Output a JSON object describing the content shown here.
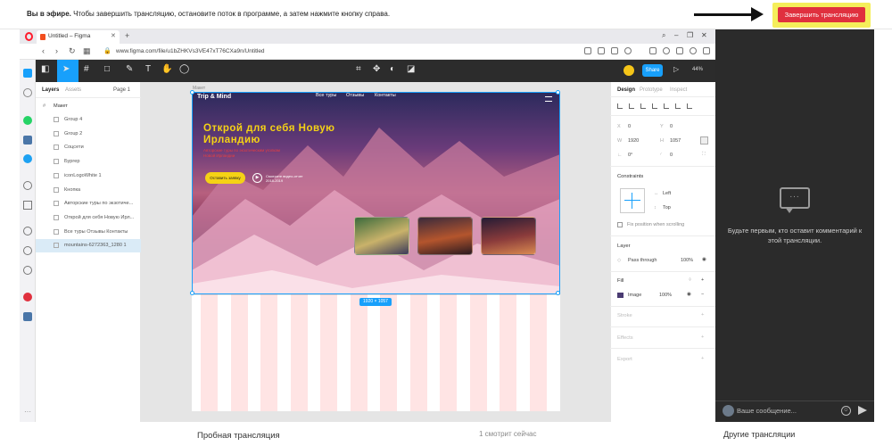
{
  "live_bar": {
    "bold": "Вы в эфире.",
    "text": " Чтобы завершить трансляцию, остановите поток в программе, а затем нажмите кнопку справа.",
    "end_button": "Завершить трансляцию",
    "accent": "#e0303e",
    "highlight": "#f5ee5a"
  },
  "browser": {
    "tab_title": "Untitled – Figma",
    "url": "www.figma.com/file/u1bZHKVs3VE47xT76CXa9n/Untitled"
  },
  "figma": {
    "share_label": "Share",
    "zoom": "44%",
    "accent": "#18a0fb",
    "layers": {
      "tab_layers": "Layers",
      "tab_assets": "Assets",
      "page": "Page 1",
      "frame": "Макет",
      "items": [
        {
          "label": "Group 4"
        },
        {
          "label": "Group 2"
        },
        {
          "label": "Соцсети"
        },
        {
          "label": "Бургер"
        },
        {
          "label": "iconLogoWhite 1"
        },
        {
          "label": "Кнопка"
        },
        {
          "label": "Авторские туры по экзотиче..."
        },
        {
          "label": "Открой для себя Новую Ирл..."
        },
        {
          "label": "Все туры Отзывы Контакты"
        },
        {
          "label": "mountains-6272363_1280 1"
        }
      ]
    },
    "canvas": {
      "frame_label": "Макет",
      "size_badge": "1920 × 1057",
      "hero": {
        "logo": "Trip & Mind",
        "nav": [
          "Все туры",
          "Отзывы",
          "Контакты"
        ],
        "title": "Открой для себя Новую Ирландию",
        "subtitle": "Авторские туры по экзотическим уголкам Новой Ирландии",
        "button": "Оставить заявку",
        "video": "Смотрите видео-отчет 2018-2019"
      }
    },
    "props": {
      "tab_design": "Design",
      "tab_prototype": "Prototype",
      "tab_inspect": "Inspect",
      "x_label": "X",
      "x_value": "0",
      "y_label": "Y",
      "y_value": "0",
      "w_label": "W",
      "w_value": "1920",
      "h_label": "H",
      "h_value": "1057",
      "rotation": "0°",
      "radius": "0",
      "constraints_title": "Constraints",
      "constraint_h": "Left",
      "constraint_v": "Top",
      "fix_position": "Fix position when scrolling",
      "layer_title": "Layer",
      "blend": "Pass through",
      "layer_opacity": "100%",
      "fill_title": "Fill",
      "fill_type": "Image",
      "fill_opacity": "100%",
      "stroke_title": "Stroke",
      "effects_title": "Effects",
      "export_title": "Export"
    },
    "help": "?"
  },
  "chat": {
    "empty_text": "Будьте первым, кто оставит комментарий к этой трансляции.",
    "placeholder": "Ваше сообщение...",
    "dots": "..."
  },
  "footer": {
    "title": "Пробная трансляция",
    "viewers": "1 смотрит сейчас",
    "other": "Другие трансляции"
  }
}
